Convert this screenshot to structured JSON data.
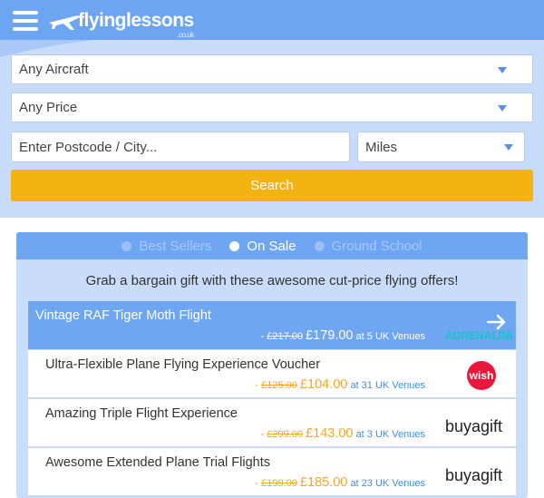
{
  "header": {
    "logo_text": "flyinglessons",
    "logo_sub": ".co.uk"
  },
  "search": {
    "aircraft": "Any Aircraft",
    "price": "Any Price",
    "postcode_placeholder": "Enter Postcode / City...",
    "distance": "Miles",
    "button_label": "Search"
  },
  "tabs": [
    {
      "label": "Best Sellers",
      "active": false
    },
    {
      "label": "On Sale",
      "active": true
    },
    {
      "label": "Ground School",
      "active": false
    }
  ],
  "heading": "Grab a bargain gift with these awesome cut-price flying offers!",
  "offers": [
    {
      "title": "Vintage RAF Tiger Moth Flight",
      "was": "£217.00",
      "now": "£179.00",
      "venues": "at 5 UK Venues",
      "vendor": "adrenaline",
      "vendor_text": "ADRENALINE"
    },
    {
      "title": "Ultra-Flexible Plane Flying Experience Voucher",
      "was": "£125.00",
      "now": "£104.00",
      "venues": "at 31 UK Venues",
      "vendor": "wish",
      "vendor_text": "wish"
    },
    {
      "title": "Amazing Triple Flight Experience",
      "was": "£299.00",
      "now": "£143.00",
      "venues": "at 3 UK Venues",
      "vendor": "buyagift",
      "vendor_text": "buyagift"
    },
    {
      "title": "Awesome Extended Plane Trial Flights",
      "was": "£199.00",
      "now": "£185.00",
      "venues": "at 23 UK Venues",
      "vendor": "buyagift",
      "vendor_text": "buyagift"
    }
  ],
  "colors": {
    "brand_blue": "#6ea5f3",
    "accent_orange": "#f5b312",
    "price_orange": "#f5a623",
    "venue_blue": "#3d8fe0"
  }
}
